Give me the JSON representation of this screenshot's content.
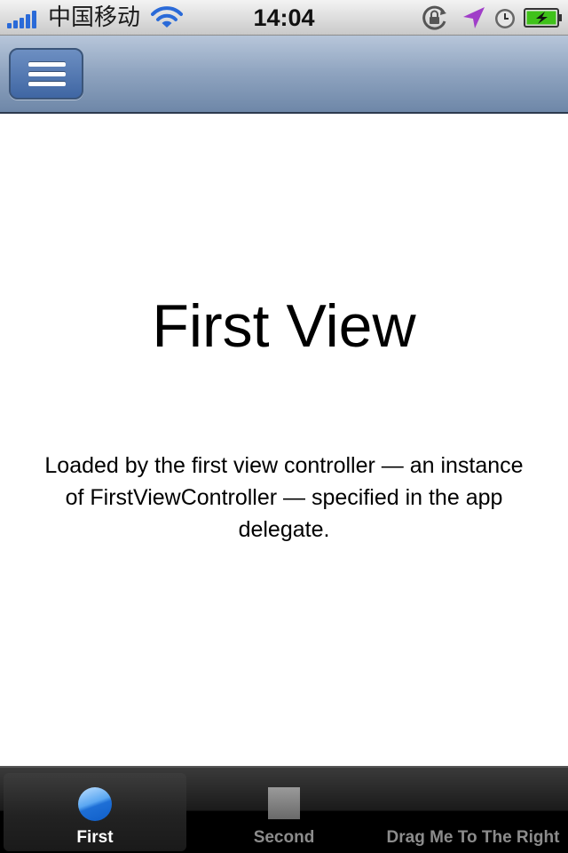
{
  "status_bar": {
    "carrier": "中国移动",
    "time": "14:04"
  },
  "nav_bar": {
    "menu_icon": "hamburger-menu-icon"
  },
  "main": {
    "title": "First View",
    "description": "Loaded by the first view controller — an instance of FirstViewController — specified in the app delegate."
  },
  "tab_bar": {
    "tabs": [
      {
        "label": "First",
        "selected": true
      },
      {
        "label": "Second",
        "selected": false
      },
      {
        "label": "Drag Me To The Right",
        "selected": false
      }
    ]
  },
  "colors": {
    "nav_bar": "#8ea3bf",
    "menu_button": "#4f75b0",
    "tab_selected_icon": "#3a8ae6",
    "battery": "#3fc21a"
  }
}
